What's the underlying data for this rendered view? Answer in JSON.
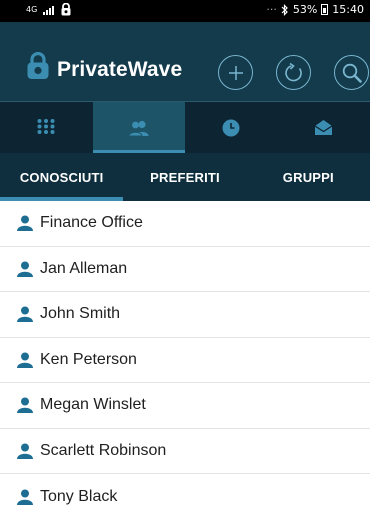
{
  "status_bar": {
    "network": "4G",
    "dots": "···",
    "battery": "53%",
    "time": "15:40"
  },
  "app": {
    "title": "PrivateWave"
  },
  "nav": {
    "items": [
      {
        "icon": "dialpad-icon"
      },
      {
        "icon": "contacts-icon",
        "active": true
      },
      {
        "icon": "clock-icon"
      },
      {
        "icon": "envelope-icon"
      }
    ]
  },
  "tabs": [
    {
      "label": "CONOSCIUTI",
      "active": true
    },
    {
      "label": "PREFERITI"
    },
    {
      "label": "GRUPPI"
    }
  ],
  "contacts": [
    {
      "name": "Finance Office"
    },
    {
      "name": "Jan Alleman"
    },
    {
      "name": "John Smith"
    },
    {
      "name": "Ken Peterson"
    },
    {
      "name": "Megan Winslet"
    },
    {
      "name": "Scarlett Robinson"
    },
    {
      "name": "Tony Black"
    }
  ],
  "colors": {
    "app_bar": "#133b4c",
    "nav_bg": "#0d2532",
    "accent": "#3b8eb2",
    "icon_blue": "#1e6e94"
  }
}
